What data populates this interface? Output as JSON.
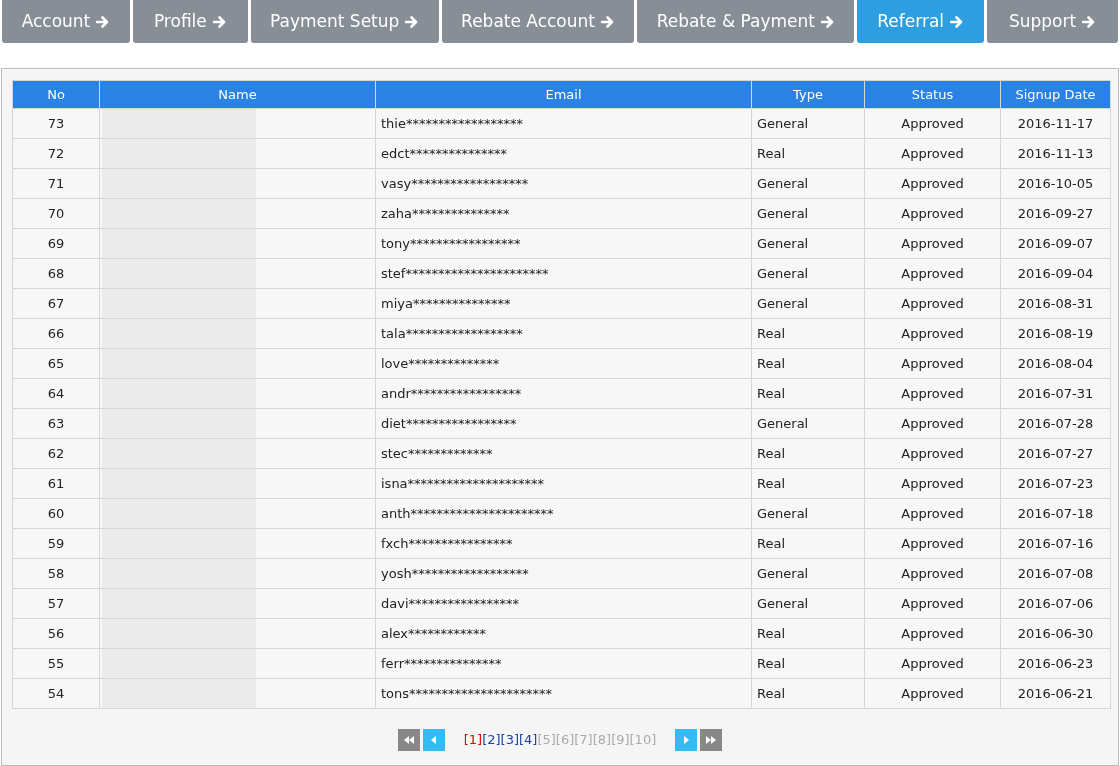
{
  "nav_tabs": [
    {
      "label": "Account",
      "selected": false
    },
    {
      "label": "Profile",
      "selected": false
    },
    {
      "label": "Payment Setup",
      "selected": false
    },
    {
      "label": "Rebate Account",
      "selected": false
    },
    {
      "label": "Rebate & Payment",
      "selected": false
    },
    {
      "label": "Referral",
      "selected": true
    },
    {
      "label": "Support",
      "selected": false
    }
  ],
  "table": {
    "columns": [
      "No",
      "Name",
      "Email",
      "Type",
      "Status",
      "Signup Date"
    ],
    "rows": [
      {
        "no": "73",
        "email": "thie******************",
        "type": "General",
        "status": "Approved",
        "signup_date": "2016-11-17"
      },
      {
        "no": "72",
        "email": "edct***************",
        "type": "Real",
        "status": "Approved",
        "signup_date": "2016-11-13"
      },
      {
        "no": "71",
        "email": "vasy******************",
        "type": "General",
        "status": "Approved",
        "signup_date": "2016-10-05"
      },
      {
        "no": "70",
        "email": "zaha***************",
        "type": "General",
        "status": "Approved",
        "signup_date": "2016-09-27"
      },
      {
        "no": "69",
        "email": "tony*****************",
        "type": "General",
        "status": "Approved",
        "signup_date": "2016-09-07"
      },
      {
        "no": "68",
        "email": "stef**********************",
        "type": "General",
        "status": "Approved",
        "signup_date": "2016-09-04"
      },
      {
        "no": "67",
        "email": "miya***************",
        "type": "General",
        "status": "Approved",
        "signup_date": "2016-08-31"
      },
      {
        "no": "66",
        "email": "tala******************",
        "type": "Real",
        "status": "Approved",
        "signup_date": "2016-08-19"
      },
      {
        "no": "65",
        "email": "love**************",
        "type": "Real",
        "status": "Approved",
        "signup_date": "2016-08-04"
      },
      {
        "no": "64",
        "email": "andr*****************",
        "type": "Real",
        "status": "Approved",
        "signup_date": "2016-07-31"
      },
      {
        "no": "63",
        "email": "diet*****************",
        "type": "General",
        "status": "Approved",
        "signup_date": "2016-07-28"
      },
      {
        "no": "62",
        "email": "stec*************",
        "type": "Real",
        "status": "Approved",
        "signup_date": "2016-07-27"
      },
      {
        "no": "61",
        "email": "isna*********************",
        "type": "Real",
        "status": "Approved",
        "signup_date": "2016-07-23"
      },
      {
        "no": "60",
        "email": "anth**********************",
        "type": "General",
        "status": "Approved",
        "signup_date": "2016-07-18"
      },
      {
        "no": "59",
        "email": "fxch****************",
        "type": "Real",
        "status": "Approved",
        "signup_date": "2016-07-16"
      },
      {
        "no": "58",
        "email": "yosh******************",
        "type": "General",
        "status": "Approved",
        "signup_date": "2016-07-08"
      },
      {
        "no": "57",
        "email": "davi*****************",
        "type": "General",
        "status": "Approved",
        "signup_date": "2016-07-06"
      },
      {
        "no": "56",
        "email": "alex************",
        "type": "Real",
        "status": "Approved",
        "signup_date": "2016-06-30"
      },
      {
        "no": "55",
        "email": "ferr***************",
        "type": "Real",
        "status": "Approved",
        "signup_date": "2016-06-23"
      },
      {
        "no": "54",
        "email": "tons**********************",
        "type": "Real",
        "status": "Approved",
        "signup_date": "2016-06-21"
      }
    ]
  },
  "pagination": {
    "pages": [
      {
        "label": "[1]",
        "selected": true,
        "disabled": false
      },
      {
        "label": "[2]",
        "selected": false,
        "disabled": false
      },
      {
        "label": "[3]",
        "selected": false,
        "disabled": false
      },
      {
        "label": "[4]",
        "selected": false,
        "disabled": false
      },
      {
        "label": "[5]",
        "selected": false,
        "disabled": true
      },
      {
        "label": "[6]",
        "selected": false,
        "disabled": true
      },
      {
        "label": "[7]",
        "selected": false,
        "disabled": true
      },
      {
        "label": "[8]",
        "selected": false,
        "disabled": true
      },
      {
        "label": "[9]",
        "selected": false,
        "disabled": true
      },
      {
        "label": "[10]",
        "selected": false,
        "disabled": true
      }
    ]
  }
}
